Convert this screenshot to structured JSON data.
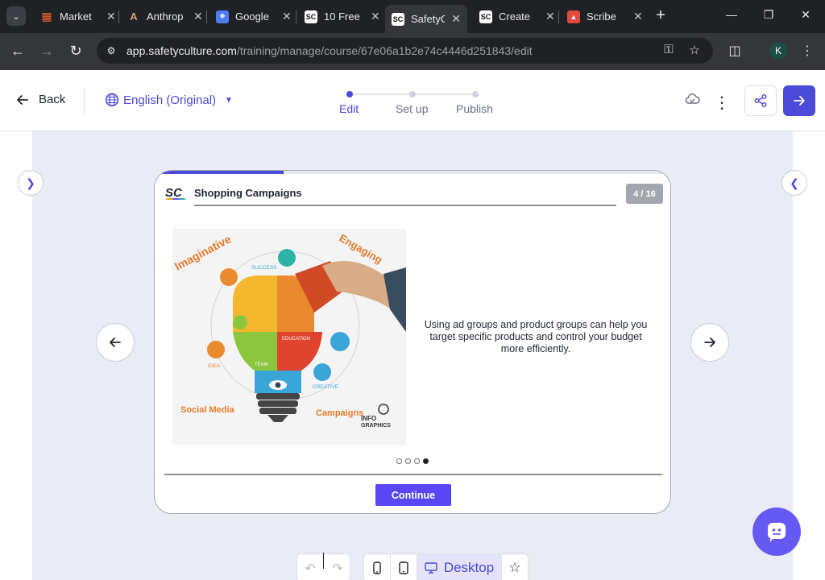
{
  "browser": {
    "tabs": [
      {
        "title": "Market",
        "favicon": "orange-grid-icon",
        "color": "#f0642e"
      },
      {
        "title": "Anthrop",
        "favicon": "anthropic-icon",
        "color": "#d4a27f"
      },
      {
        "title": "Google",
        "favicon": "butterfly-icon",
        "color": "#4f7cf6"
      },
      {
        "title": "10 Free",
        "favicon": "sc-icon",
        "color": "#ffffff"
      },
      {
        "title": "SafetyC",
        "favicon": "sc-icon",
        "color": "#ffffff"
      },
      {
        "title": "Create",
        "favicon": "sc-icon",
        "color": "#ffffff"
      },
      {
        "title": "Scribe",
        "favicon": "scribe-icon",
        "color": "#e04a3f"
      }
    ],
    "active_tab_index": 4,
    "url_domain": "app.safetyculture.com",
    "url_path": "/training/manage/course/67e06a1b2e74c4446d251843/edit",
    "profile_initial": "K"
  },
  "header": {
    "back_label": "Back",
    "language_label": "English (Original)",
    "steps": [
      {
        "label": "Edit",
        "active": true
      },
      {
        "label": "Set up",
        "active": false
      },
      {
        "label": "Publish",
        "active": false
      }
    ]
  },
  "slide": {
    "course_title": "Shopping Campaigns",
    "page_indicator": "4 / 16",
    "progress_fraction": 0.25,
    "image_labels": {
      "imaginative": "Imaginative",
      "engaging": "Engaging",
      "success": "SUCCESS",
      "education": "EDUCATION",
      "team": "TEAM",
      "idea": "IDEA",
      "creative": "CREATIVE",
      "social_media": "Social Media",
      "campaigns": "Campaigns",
      "info": "INFO",
      "graphics": "GRAPHICS"
    },
    "body_text": "Using ad groups and product groups can help you target specific products and control your budget more efficiently.",
    "dots_total": 4,
    "dots_active_index": 3,
    "continue_label": "Continue"
  },
  "bottom_toolbar": {
    "view_label": "Desktop"
  },
  "colors": {
    "accent": "#4b49d8",
    "button": "#5b46f5",
    "fab": "#6559f4"
  }
}
